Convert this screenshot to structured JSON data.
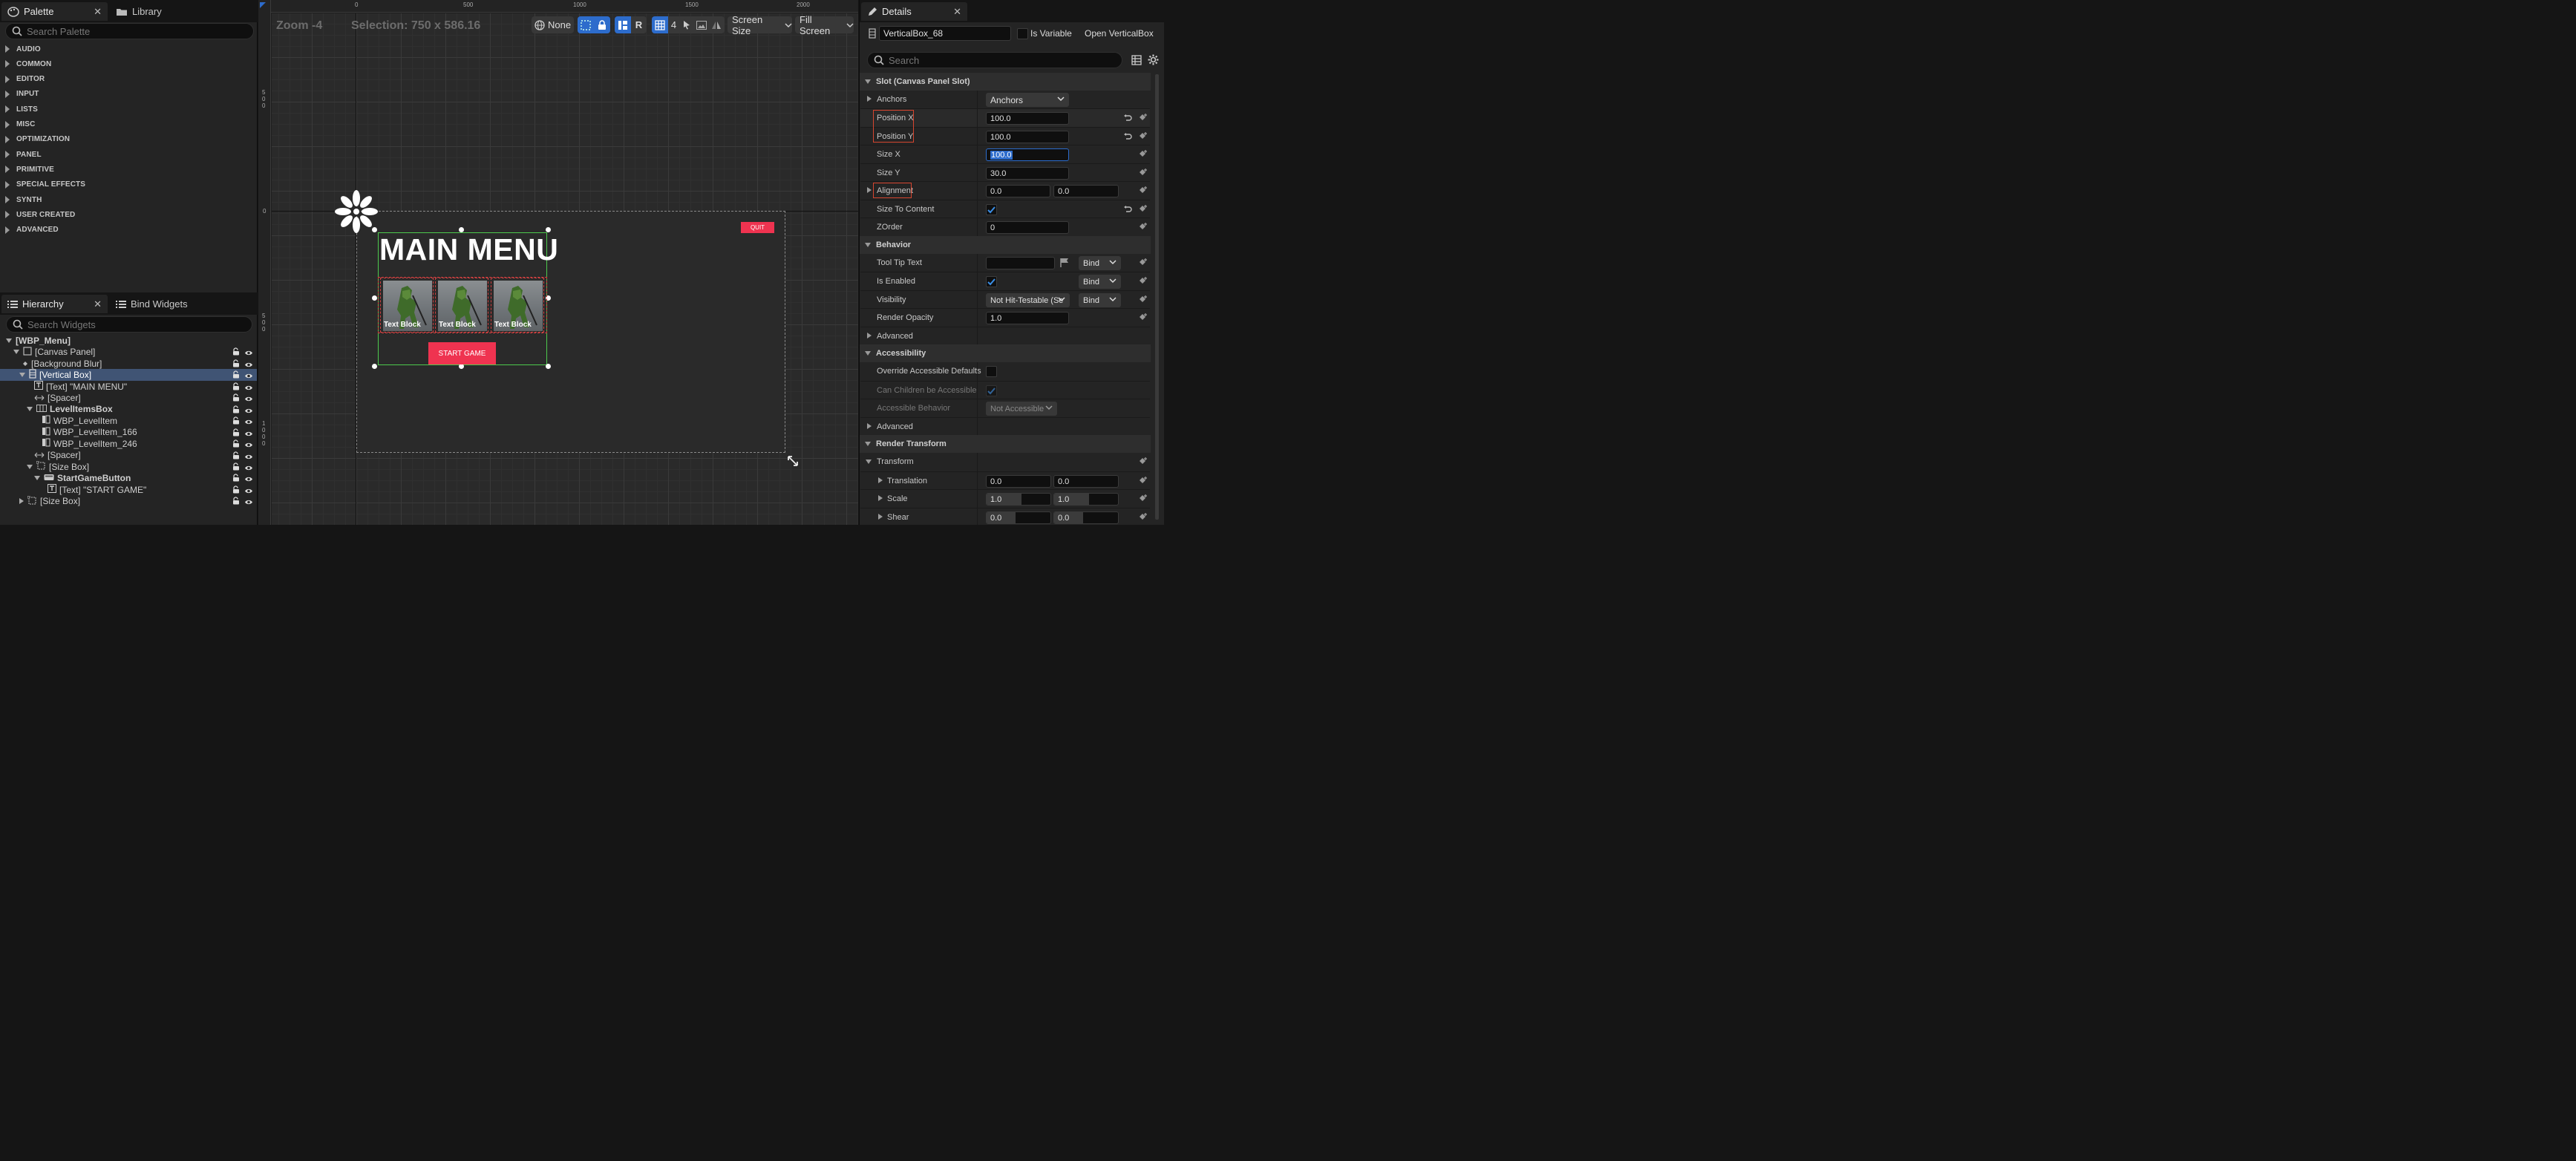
{
  "palette": {
    "tab_label": "Palette",
    "library_tab_label": "Library",
    "search_placeholder": "Search Palette",
    "categories": [
      "AUDIO",
      "COMMON",
      "EDITOR",
      "INPUT",
      "LISTS",
      "MISC",
      "OPTIMIZATION",
      "PANEL",
      "PRIMITIVE",
      "SPECIAL EFFECTS",
      "SYNTH",
      "USER CREATED",
      "ADVANCED"
    ]
  },
  "hierarchy": {
    "tab_label": "Hierarchy",
    "bind_tab_label": "Bind Widgets",
    "search_placeholder": "Search Widgets",
    "rows": [
      {
        "label": "[WBP_Menu]"
      },
      {
        "label": "[Canvas Panel]"
      },
      {
        "label": "[Background Blur]"
      },
      {
        "label": "[Vertical Box]"
      },
      {
        "label": "[Text] \"MAIN MENU\""
      },
      {
        "label": "[Spacer]"
      },
      {
        "label": "LevelItemsBox"
      },
      {
        "label": "WBP_LevelItem"
      },
      {
        "label": "WBP_LevelItem_166"
      },
      {
        "label": "WBP_LevelItem_246"
      },
      {
        "label": "[Spacer]"
      },
      {
        "label": "[Size Box]"
      },
      {
        "label": "StartGameButton"
      },
      {
        "label": "[Text] \"START GAME\""
      },
      {
        "label": "[Size Box]"
      }
    ]
  },
  "viewport": {
    "zoom_label": "Zoom -4",
    "selection_label": "Selection: 750 x 586.16",
    "ruler_top": [
      "0",
      "500",
      "1000",
      "1500",
      "2000"
    ],
    "ruler_left": [
      "500",
      "0",
      "500",
      "1000"
    ],
    "toolbar": {
      "none_label": "None",
      "r_label": "R",
      "grid_count": "4",
      "screen_size_label": "Screen Size",
      "fill_screen_label": "Fill Screen"
    },
    "canvas": {
      "title": "MAIN MENU",
      "item_label": "Text Block",
      "start_button": "START GAME",
      "quit_button": "QUIT"
    }
  },
  "details": {
    "tab_label": "Details",
    "widget_name": "VerticalBox_68",
    "is_variable_label": "Is Variable",
    "open_link": "Open VerticalBox",
    "search_placeholder": "Search",
    "sections": {
      "slot": "Slot (Canvas Panel Slot)",
      "behavior": "Behavior",
      "accessibility": "Accessibility",
      "render_transform": "Render Transform"
    },
    "props": {
      "anchors_label": "Anchors",
      "anchors_value": "Anchors",
      "position_x_label": "Position X",
      "position_x_value": "100.0",
      "position_y_label": "Position Y",
      "position_y_value": "100.0",
      "size_x_label": "Size X",
      "size_x_value": "100.0",
      "size_y_label": "Size Y",
      "size_y_value": "30.0",
      "alignment_label": "Alignment",
      "alignment_x": "0.0",
      "alignment_y": "0.0",
      "size_to_content_label": "Size To Content",
      "zorder_label": "ZOrder",
      "zorder_value": "0",
      "tooltip_label": "Tool Tip Text",
      "bind_label": "Bind",
      "is_enabled_label": "Is Enabled",
      "visibility_label": "Visibility",
      "visibility_value": "Not Hit-Testable (Se",
      "render_opacity_label": "Render Opacity",
      "render_opacity_value": "1.0",
      "advanced_label": "Advanced",
      "override_acc_label": "Override Accessible Defaults",
      "can_children_label": "Can Children be Accessible",
      "acc_behavior_label": "Accessible Behavior",
      "acc_behavior_value": "Not Accessible",
      "advanced2_label": "Advanced",
      "transform_label": "Transform",
      "translation_label": "Translation",
      "translation_x": "0.0",
      "translation_y": "0.0",
      "scale_label": "Scale",
      "scale_x": "1.0",
      "scale_y": "1.0",
      "shear_label": "Shear",
      "shear_x": "0.0",
      "shear_y": "0.0"
    }
  },
  "colors": {
    "accent": "#2d6ccc",
    "selection_row": "#405474",
    "button_red": "#ef3350",
    "highlight_box": "#d6452f",
    "vbox_outline": "#4dc94d"
  }
}
